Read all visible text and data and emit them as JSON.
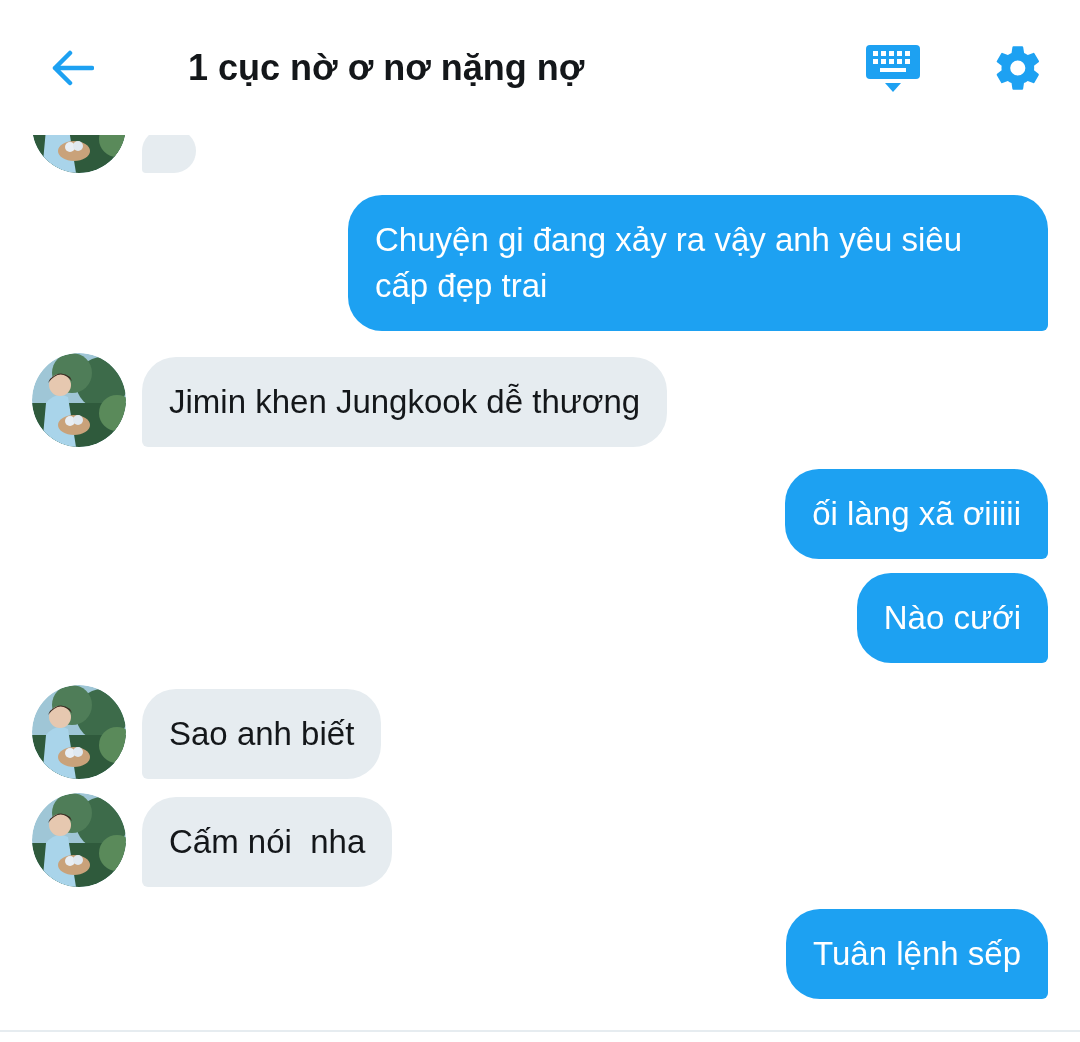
{
  "header": {
    "title": "1 cục nờ ơ nơ nặng nợ"
  },
  "messages": [
    {
      "kind": "received"
    },
    {
      "kind": "sent",
      "text": "Chuyện gi đang xảy ra vậy anh yêu siêu cấp đẹp trai"
    },
    {
      "kind": "received",
      "text": "Jimin khen Jungkook dễ thương"
    },
    {
      "kind": "sent",
      "text": "ối làng xã ơiiiii"
    },
    {
      "kind": "sent",
      "text": "Nào cưới"
    },
    {
      "kind": "received",
      "text": "Sao anh biết"
    },
    {
      "kind": "received",
      "text": "Cấm nói  nha"
    },
    {
      "kind": "sent",
      "text": "Tuân lệnh sếp"
    }
  ]
}
